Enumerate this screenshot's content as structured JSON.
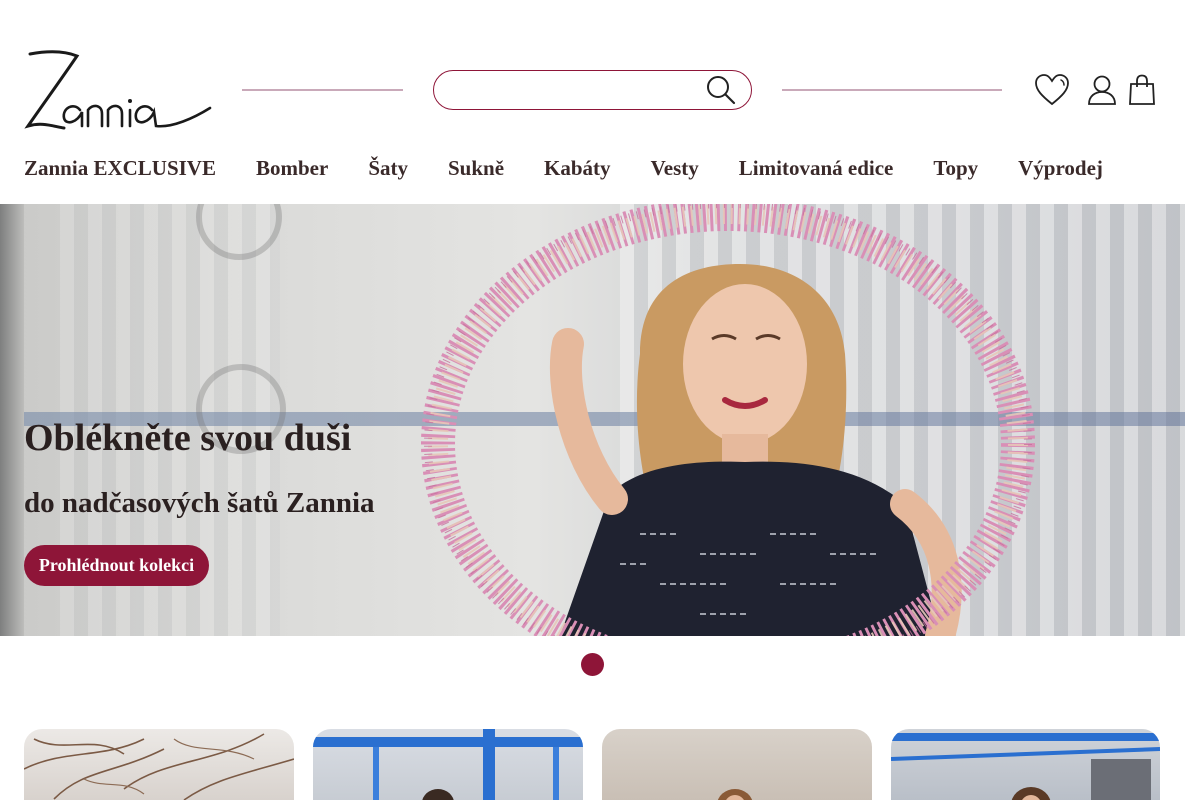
{
  "header": {
    "logo_text": "Zannia",
    "search": {
      "placeholder": "",
      "value": ""
    },
    "icons": {
      "search": "search-icon",
      "wishlist": "heart-icon",
      "account": "user-icon",
      "cart": "shopping-bag-icon"
    }
  },
  "nav": {
    "items": [
      {
        "label": "Zannia EXCLUSIVE"
      },
      {
        "label": "Bomber"
      },
      {
        "label": "Šaty"
      },
      {
        "label": "Sukně"
      },
      {
        "label": "Kabáty"
      },
      {
        "label": "Vesty"
      },
      {
        "label": "Limitovaná edice"
      },
      {
        "label": "Topy"
      },
      {
        "label": "Výprodej"
      }
    ],
    "more_glyph": ""
  },
  "hero": {
    "title": "Oblékněte svou duši",
    "subtitle": "do nadčasových šatů Zannia",
    "cta_label": "Prohlédnout kolekci"
  },
  "slider": {
    "active_slide": 1,
    "slide_count": 1
  },
  "colors": {
    "brand": "#8e1538",
    "decor_line": "#c9a9b9",
    "text": "#2a2020"
  }
}
